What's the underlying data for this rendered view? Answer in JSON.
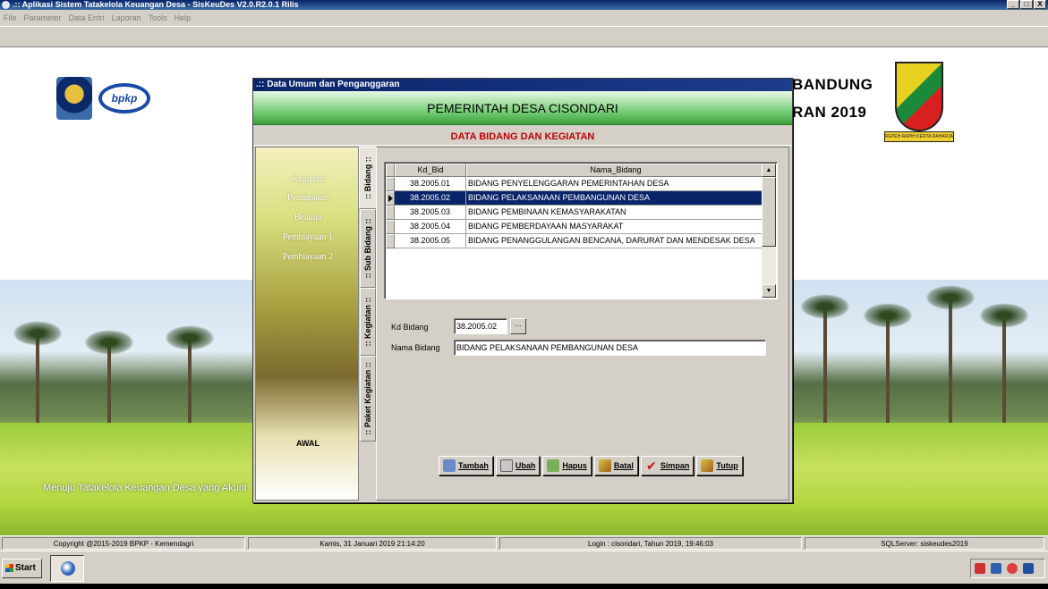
{
  "window": {
    "title": ".:: Aplikasi Sistem Tatakelola Keuangan Desa - SisKeuDes V2.0.R2.0.1 Rilis",
    "controls": [
      "_",
      "□",
      "X"
    ]
  },
  "menu": [
    "File",
    "Parameter",
    "Data Entri",
    "Laporan",
    "Tools",
    "Help"
  ],
  "background": {
    "headline_1": "BANDUNG",
    "headline_2": "RAN 2019",
    "logo_text": "bpkp",
    "ribbon_text": "REPEH RAPIH KERTA RAHARJA",
    "tagline": "Menuju Tatakelola Keuangan Desa yang Akunt"
  },
  "dialog": {
    "title": ".:: Data Umum dan Penganggaran",
    "banner": "PEMERINTAH DESA CISONDARI",
    "subheading": "DATA BIDANG DAN KEGIATAN",
    "side_menu": [
      "Kegiatan",
      "Pendapatan",
      "Belanja",
      "Pembiayaan 1",
      "Pembiayaan 2"
    ],
    "side_bottom": "AWAL",
    "tabs": [
      ":: Bidang ::",
      ":: Sub Bidang ::",
      ":: Kegiatan ::",
      ":: Paket Kegiatan ::"
    ],
    "grid": {
      "columns": [
        "Kd_Bid",
        "Nama_Bidang"
      ],
      "rows": [
        {
          "kd": "38.2005.01",
          "nama": "BIDANG PENYELENGGARAN PEMERINTAHAN DESA"
        },
        {
          "kd": "38.2005.02",
          "nama": "BIDANG PELAKSANAAN PEMBANGUNAN DESA"
        },
        {
          "kd": "38.2005.03",
          "nama": "BIDANG PEMBINAAN KEMASYARAKATAN"
        },
        {
          "kd": "38.2005.04",
          "nama": "BIDANG PEMBERDAYAAN MASYARAKAT"
        },
        {
          "kd": "38.2005.05",
          "nama": "BIDANG PENANGGULANGAN BENCANA, DARURAT DAN MENDESAK DESA"
        }
      ],
      "selected_index": 1
    },
    "form": {
      "kd_label": "Kd Bidang",
      "kd_value": "38.2005.02",
      "lookup_label": "...",
      "nama_label": "Nama Bidang",
      "nama_value": "BIDANG PELAKSANAAN PEMBANGUNAN DESA"
    },
    "buttons": {
      "tambah": "Tambah",
      "ubah": "Ubah",
      "hapus": "Hapus",
      "batal": "Batal",
      "simpan": "Simpan",
      "tutup": "Tutup"
    }
  },
  "status": {
    "copyright": "Copyright @2015-2019 BPKP - Kemendagri",
    "datetime": "Kamis, 31 Januari 2019  21:14:20",
    "login": "Login : cisondari,  Tahun 2019, 19:46:03",
    "server": "SQLServer: siskeudes2019"
  },
  "taskbar": {
    "start_label": "Start"
  },
  "colors": {
    "title_bar": "#0a246a",
    "selection": "#0a246a",
    "subheading": "#c00000",
    "banner_green": "#3aa03a"
  }
}
